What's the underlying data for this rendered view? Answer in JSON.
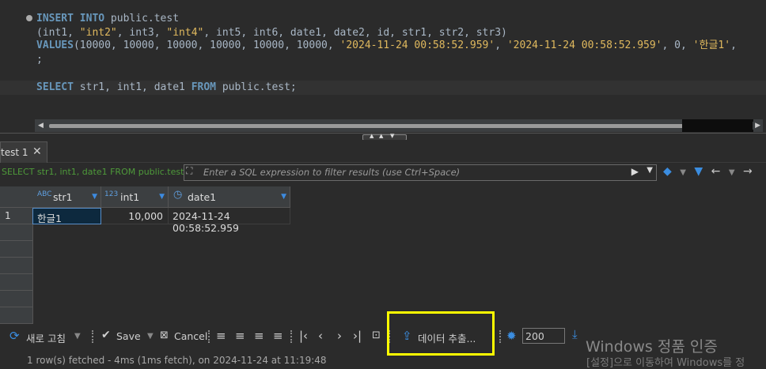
{
  "editor": {
    "line1_kw1": "INSERT",
    "line1_kw2": "INTO",
    "line1_rest": " public.test",
    "line2_a": "(int1, ",
    "line2_s1": "\"int2\"",
    "line2_b": ", int3, ",
    "line2_s2": "\"int4\"",
    "line2_c": ", int5, int6, date1, date2, id, str1, str2, str3)",
    "line3_kw": "VALUES",
    "line3_a": "(10000, 10000, 10000, 10000, 10000, 10000, ",
    "line3_s1": "'2024-11-24 00:58:52.959'",
    "line3_b": ", ",
    "line3_s2": "'2024-11-24 00:58:52.959'",
    "line3_c": ", 0, ",
    "line3_s3": "'한글1'",
    "line3_d": ",",
    "line4": ";",
    "line6_kw1": "SELECT",
    "line6_a": " str1, int1, date1 ",
    "line6_kw2": "FROM",
    "line6_b": " public.test;"
  },
  "result_tab": {
    "label": "test 1",
    "close": "✕"
  },
  "filter": {
    "query_text": "SELECT str1, int1, date1 FROM public.test",
    "placeholder": "Enter a SQL expression to filter results (use Ctrl+Space)"
  },
  "grid": {
    "columns": [
      {
        "name": "str1",
        "type_icon": "ABC-icon",
        "type_label": "ABC"
      },
      {
        "name": "int1",
        "type_icon": "123-icon",
        "type_label": "123"
      },
      {
        "name": "date1",
        "type_icon": "clock-icon",
        "type_label": "◷"
      }
    ],
    "rows": [
      {
        "num": "1",
        "str1": "한글1",
        "int1": "10,000",
        "date1": "2024-11-24 00:58:52.959"
      }
    ]
  },
  "toolbar": {
    "refresh_label": "새로 고침",
    "save_label": "Save",
    "cancel_label": "Cancel",
    "export_label": "데이터 추출...",
    "fetch_size": "200"
  },
  "status": {
    "text": "1 row(s) fetched - 4ms (1ms fetch), on 2024-11-24 at 11:19:48"
  },
  "watermark": {
    "line1": "Windows 정품 인증",
    "line2": "[설정]으로 이동하여 Windows를 정"
  },
  "colors": {
    "accent": "#3b8de0",
    "highlight": "#ffff00",
    "background": "#2b2b2b"
  }
}
